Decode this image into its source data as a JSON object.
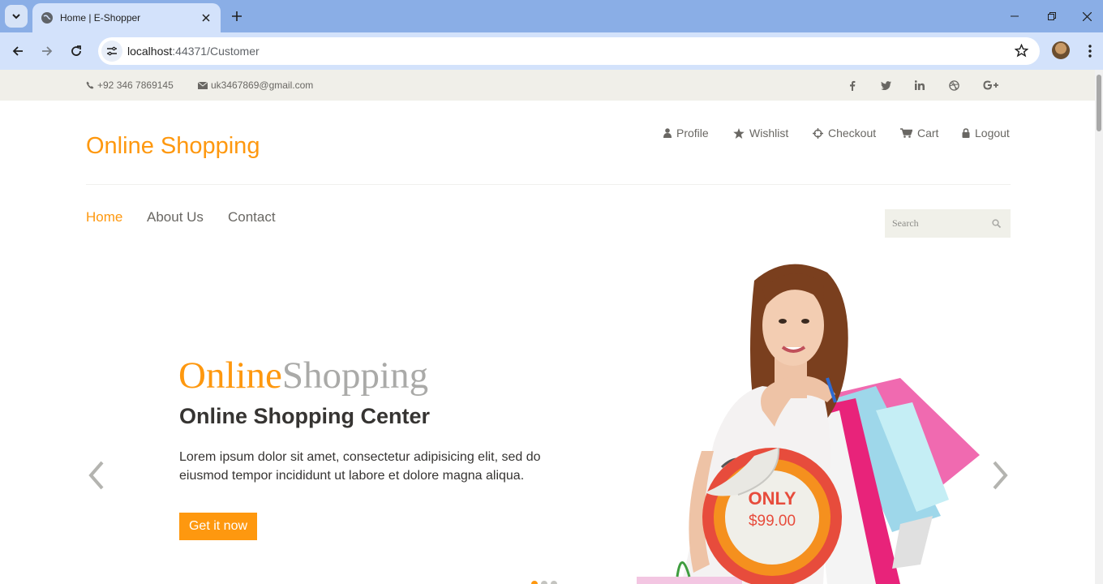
{
  "browser": {
    "tab_title": "Home | E-Shopper",
    "url_host": "localhost",
    "url_path": ":44371/Customer"
  },
  "topbar": {
    "phone": "+92 346 7869145",
    "email": "uk3467869@gmail.com",
    "social": [
      "facebook-icon",
      "twitter-icon",
      "linkedin-icon",
      "dribbble-icon",
      "google-plus-icon"
    ]
  },
  "header": {
    "logo": "Online Shopping",
    "account_links": [
      {
        "label": "Profile",
        "icon": "user-icon"
      },
      {
        "label": "Wishlist",
        "icon": "star-icon"
      },
      {
        "label": "Checkout",
        "icon": "crosshairs-icon"
      },
      {
        "label": "Cart",
        "icon": "cart-icon"
      },
      {
        "label": "Logout",
        "icon": "lock-icon"
      }
    ]
  },
  "nav": {
    "items": [
      {
        "label": "Home",
        "active": true
      },
      {
        "label": "About Us",
        "active": false
      },
      {
        "label": "Contact",
        "active": false
      }
    ],
    "search_placeholder": "Search"
  },
  "slider": {
    "title_part1": "Online",
    "title_part2": "Shopping",
    "subtitle": "Online Shopping Center",
    "text": "Lorem ipsum dolor sit amet, consectetur adipisicing elit, sed do eiusmod tempor incididunt ut labore et dolore magna aliqua.",
    "cta_label": "Get it now",
    "badge_top": "ONLY",
    "badge_price": "$99.00"
  },
  "colors": {
    "accent": "#fe980f",
    "topbar_bg": "#f0efe9",
    "text": "#696763",
    "badge_red": "#e74c3c"
  }
}
